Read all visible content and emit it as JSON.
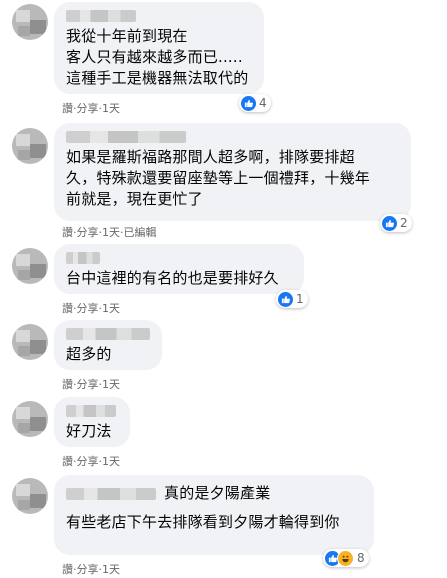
{
  "comments": [
    {
      "text": "我從十年前到現在\n客人只有越來越多而已.....\n這種手工是機器無法取代的",
      "actions": {
        "like": "讚",
        "share": "分享",
        "time": "1天"
      },
      "reaction_count": "4"
    },
    {
      "text": "如果是羅斯福路那間人超多啊，排隊要排超\n久，特殊款還要留座墊等上一個禮拜，十幾年\n前就是，現在更忙了",
      "actions": {
        "like": "讚",
        "share": "分享",
        "time": "1天",
        "edited": "已編輯"
      },
      "reaction_count": "2"
    },
    {
      "text": "台中這裡的有名的也是要排好久",
      "actions": {
        "like": "讚",
        "share": "分享",
        "time": "1天"
      },
      "reaction_count": "1"
    },
    {
      "text": "超多的",
      "actions": {
        "like": "讚",
        "share": "分享",
        "time": "1天"
      }
    },
    {
      "text": "好刀法",
      "actions": {
        "like": "讚",
        "share": "分享",
        "time": "1天"
      }
    },
    {
      "inline_text": "真的是夕陽產業",
      "text": "有些老店下午去排隊看到夕陽才輪得到你",
      "actions": {
        "like": "讚",
        "share": "分享",
        "time": "1天"
      },
      "reaction_count": "8"
    }
  ],
  "separator": "·",
  "icons": {
    "like": "like-icon",
    "haha": "haha-icon"
  },
  "colors": {
    "bubble": "#f0f2f5",
    "like": "#1877f2",
    "meta": "#65676b"
  }
}
